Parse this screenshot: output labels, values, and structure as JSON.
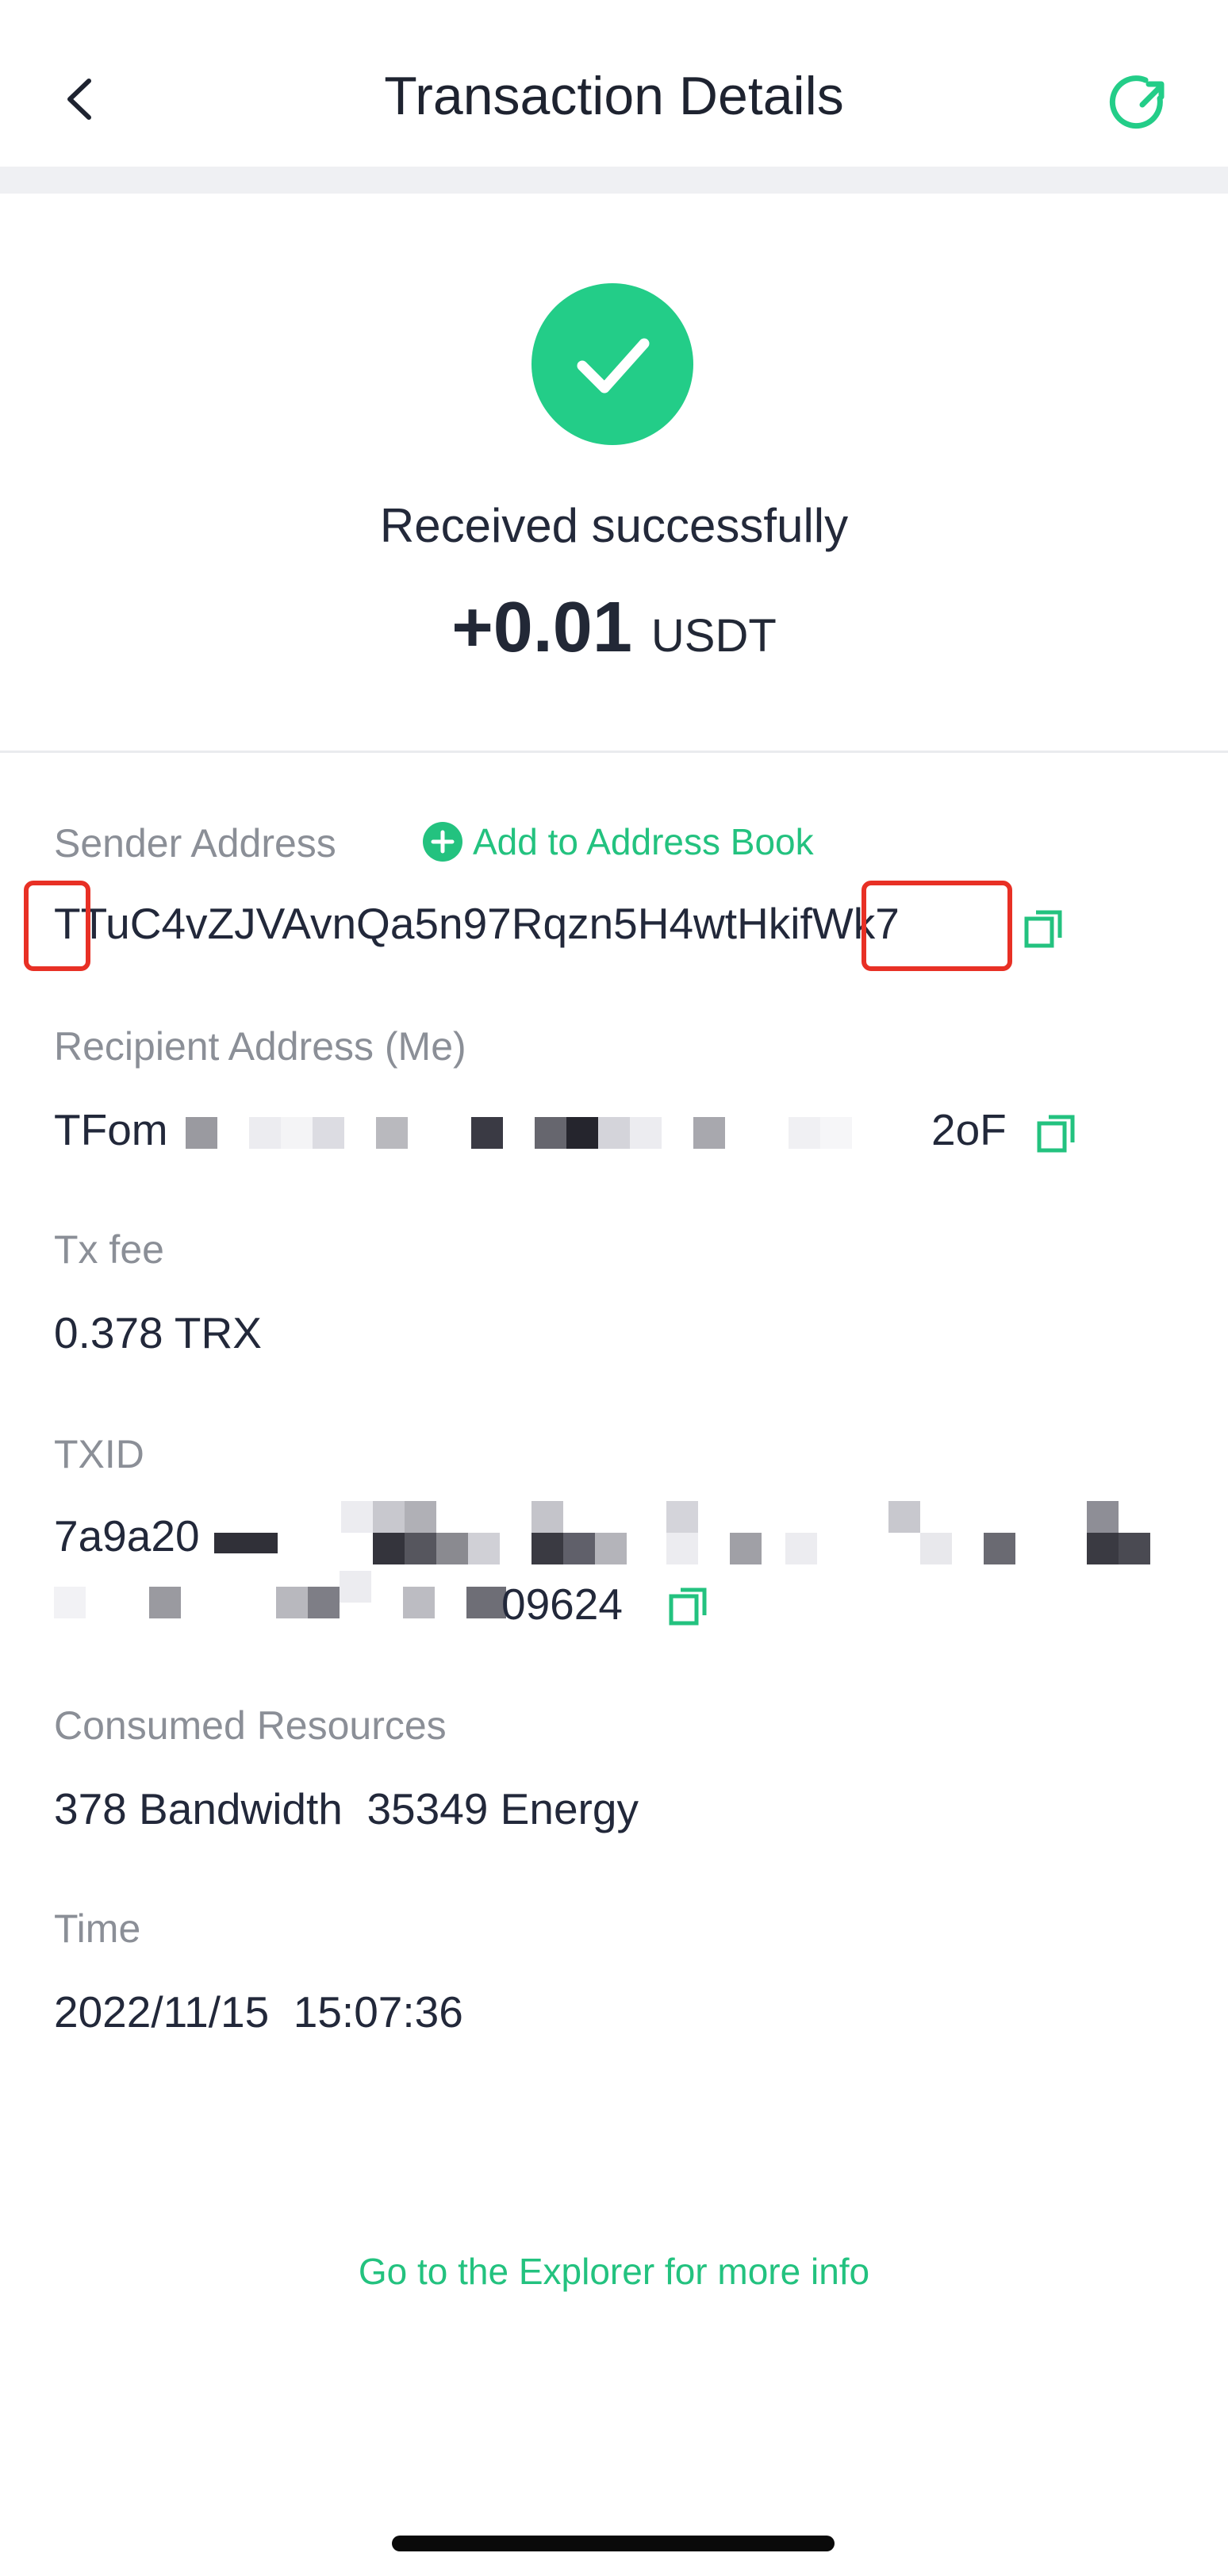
{
  "header": {
    "title": "Transaction Details",
    "back_icon": "chevron-left-icon",
    "share_icon": "refresh-share-icon"
  },
  "status": {
    "text": "Received successfully",
    "amount": "+0.01",
    "unit": "USDT",
    "icon": "check-icon",
    "accent_color": "#23cd88"
  },
  "sender": {
    "label": "Sender Address",
    "add_label": "Add to Address Book",
    "address_first": "T",
    "address_middle": "TuC4vZJVAvnQa5n97Rqzn5H4wtHk",
    "address_last": "ifWk7"
  },
  "recipient": {
    "label": "Recipient Address (Me)",
    "address_start": "TFom",
    "address_end": "2oF"
  },
  "fee": {
    "label": "Tx fee",
    "value": "0.378 TRX"
  },
  "txid": {
    "label": "TXID",
    "start": "7a9a20",
    "end": "09624"
  },
  "resources": {
    "label": "Consumed Resources",
    "value": "378 Bandwidth  35349 Energy"
  },
  "time": {
    "label": "Time",
    "value": "2022/11/15  15:07:36"
  },
  "footer": {
    "explorer_link": "Go to the Explorer for more info"
  }
}
